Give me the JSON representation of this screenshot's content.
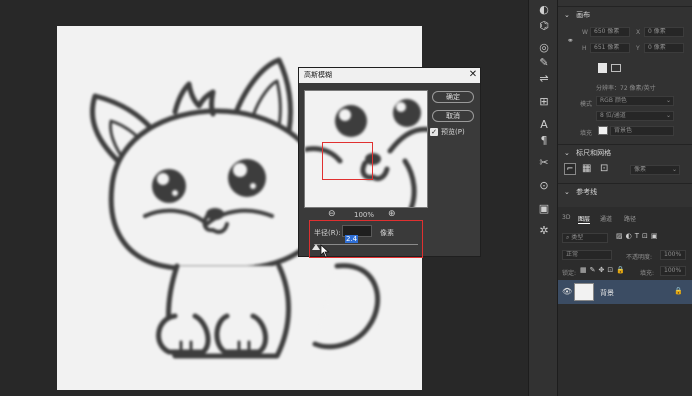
{
  "dialog": {
    "title": "高斯模糊",
    "ok_label": "确定",
    "cancel_label": "取消",
    "preview_label": "预览(P)",
    "preview_checked": true,
    "zoom_out": "⊖",
    "zoom_value": "100%",
    "zoom_in": "⊕",
    "radius_label": "半径(R):",
    "radius_value": "2.4",
    "unit": "像素",
    "slider_fraction": 0.02
  },
  "properties": {
    "canvas_section": "画布",
    "w_label": "W",
    "w_value": "650 像素",
    "x_label": "X",
    "x_value": "0 像素",
    "h_label": "H",
    "h_value": "651 像素",
    "y_label": "Y",
    "y_value": "0 像素",
    "resolution_text": "分辨率：72 像素/英寸",
    "mode_label": "模式",
    "mode_value": "RGB 颜色",
    "depth_value": "8 位/通道",
    "fill_label": "填充",
    "fill_value": "背景色",
    "rulers_section": "标尺和网格",
    "unit_value": "像素",
    "guides_section": "参考线"
  },
  "layers": {
    "tabs": [
      "3D",
      "图层",
      "通道",
      "路径"
    ],
    "active_tab": 1,
    "kind_filter": "类型",
    "blend_mode": "正常",
    "opacity_label": "不透明度:",
    "opacity_value": "100%",
    "lock_label": "锁定:",
    "fill_label": "填充:",
    "fill_value": "100%",
    "layer_name": "背景"
  },
  "tools": [
    "slice-icon",
    "eraser-icon",
    "brush-icon",
    "lasso-icon",
    "wand-icon",
    "align-icon",
    "type-icon",
    "paragraph-icon",
    "pen-icon",
    "crop-icon",
    "transform-icon",
    "3d-icon"
  ]
}
